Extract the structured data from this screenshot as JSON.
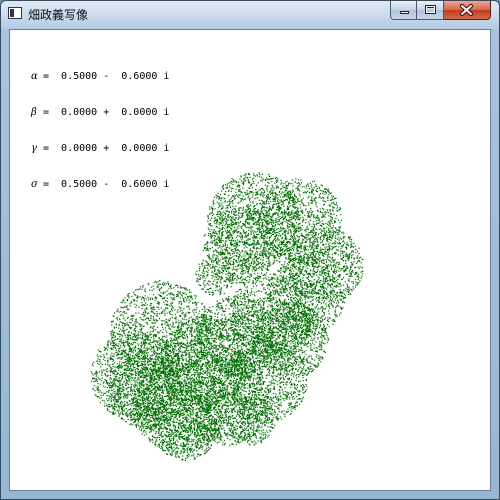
{
  "window": {
    "title": "畑政義写像"
  },
  "parameters": [
    {
      "symbol": "α",
      "text": "=  0.5000 -  0.6000 i"
    },
    {
      "symbol": "β",
      "text": "=  0.0000 +  0.0000 i"
    },
    {
      "symbol": "γ",
      "text": "=  0.0000 +  0.0000 i"
    },
    {
      "symbol": "σ",
      "text": "=  0.5000 -  0.6000 i"
    }
  ],
  "colors": {
    "fractal": "#007000",
    "close_button": "#c94a2a",
    "background": "#ffffff"
  },
  "icons": {
    "app": "window-icon",
    "minimize": "minimize-icon",
    "maximize": "maximize-icon",
    "close": "close-icon"
  }
}
